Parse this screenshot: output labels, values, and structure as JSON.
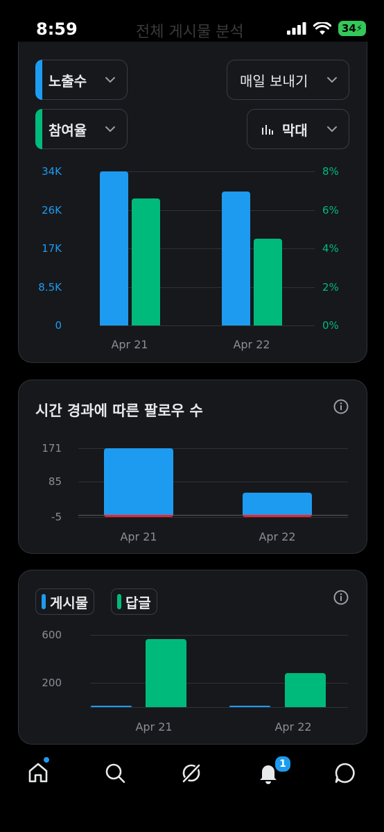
{
  "status_bar": {
    "time": "8:59",
    "ghost_title": "전체 게시물 분석",
    "battery": "34"
  },
  "colors": {
    "blue": "#1d9bf0",
    "green": "#00ba7c",
    "red": "#f4212e"
  },
  "card1": {
    "selector_primary": "노출수",
    "selector_secondary": "참여율",
    "interval": "매일 보내기",
    "chart_style": "막대"
  },
  "card2": {
    "title": "시간 경과에 따른 팔로우 수"
  },
  "card3": {
    "legend_posts": "게시물",
    "legend_replies": "답글"
  },
  "tabbar": {
    "notification_count": "1"
  },
  "chart_data": [
    {
      "type": "bar",
      "categories": [
        "Apr 21",
        "Apr 22"
      ],
      "series": [
        {
          "name": "노출수",
          "values": [
            34000,
            29500
          ]
        },
        {
          "name": "참여율",
          "values": [
            6.6,
            4.5
          ]
        }
      ],
      "y_left": {
        "ticks": [
          "0",
          "8.5K",
          "17K",
          "26K",
          "34K"
        ],
        "range": [
          0,
          34000
        ]
      },
      "y_right": {
        "ticks": [
          "0%",
          "2%",
          "4%",
          "6%",
          "8%"
        ],
        "range": [
          0,
          8
        ]
      },
      "grid": true
    },
    {
      "type": "bar",
      "categories": [
        "Apr 21",
        "Apr 22"
      ],
      "series": [
        {
          "values": [
            171,
            58
          ]
        },
        {
          "values": [
            -3,
            -3
          ]
        }
      ],
      "y_ticks": [
        "171",
        "85",
        "-5"
      ],
      "range": [
        -5,
        171
      ],
      "grid": true
    },
    {
      "type": "bar",
      "categories": [
        "Apr 21",
        "Apr 22"
      ],
      "series": [
        {
          "name": "게시물",
          "values": [
            3,
            3
          ]
        },
        {
          "name": "답글",
          "values": [
            565,
            285
          ]
        }
      ],
      "y_ticks": [
        "600",
        "200"
      ],
      "range": [
        0,
        600
      ],
      "grid": true
    }
  ]
}
